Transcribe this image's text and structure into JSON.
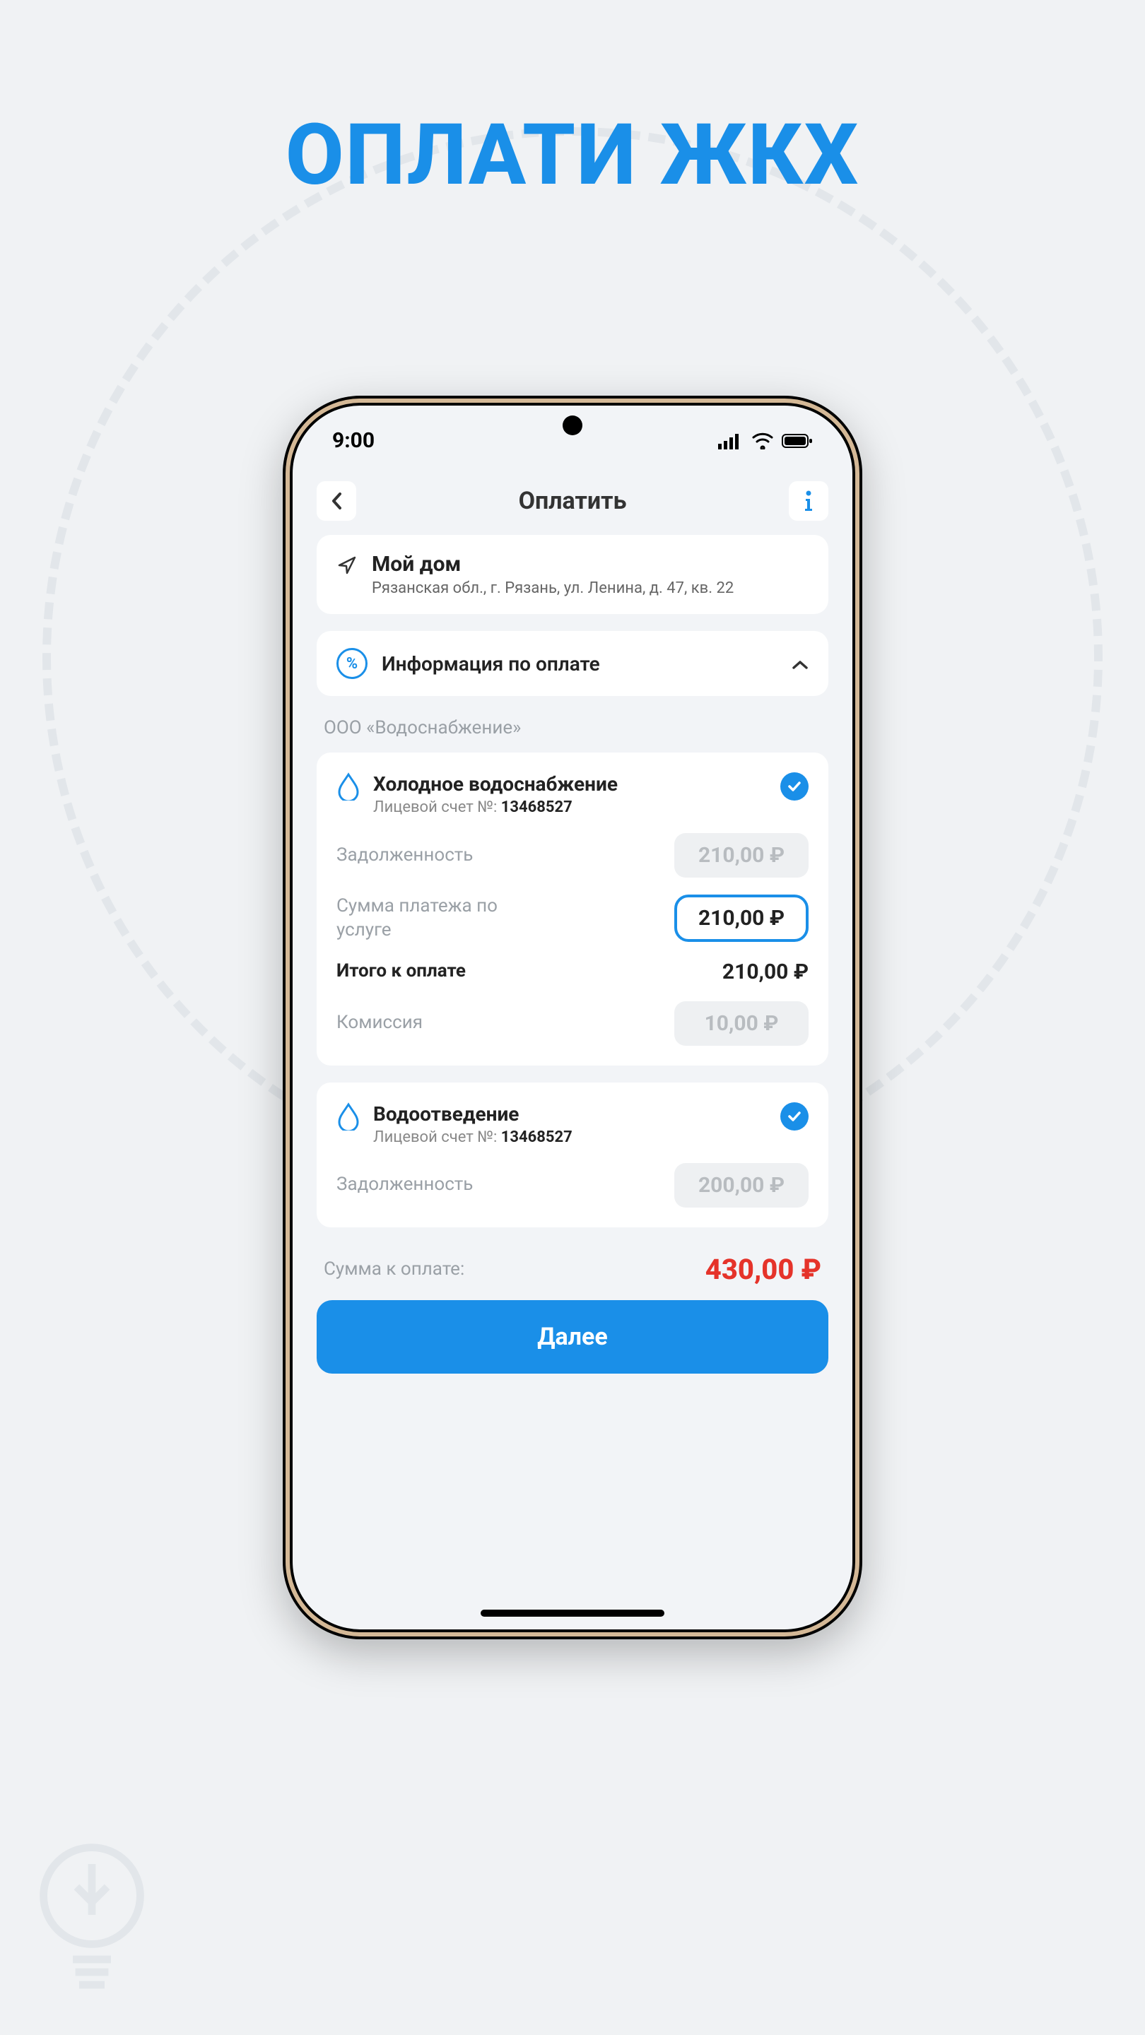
{
  "headline": "ОПЛАТИ ЖКХ",
  "status": {
    "time": "9:00"
  },
  "header": {
    "title": "Оплатить"
  },
  "address": {
    "title": "Мой дом",
    "subtitle": "Рязанская обл., г. Рязань, ул. Ленина, д. 47, кв. 22"
  },
  "payinfo": {
    "label": "Информация по оплате"
  },
  "company": "ООО «Водоснабжение»",
  "services": [
    {
      "title": "Холодное водоснабжение",
      "account_label": "Лицевой счет №:",
      "account": "13468527",
      "rows": {
        "debt_label": "Задолженность",
        "debt_value": "210,00 ₽",
        "amount_label": "Сумма платежа по услуге",
        "amount_value": "210,00 ₽",
        "total_label": "Итого к оплате",
        "total_value": "210,00 ₽",
        "fee_label": "Комиссия",
        "fee_value": "10,00 ₽"
      }
    },
    {
      "title": "Водоотведение",
      "account_label": "Лицевой счет №:",
      "account": "13468527",
      "rows": {
        "debt_label": "Задолженность",
        "debt_value": "200,00 ₽"
      }
    }
  ],
  "summary": {
    "label": "Сумма к оплате:",
    "value": "430,00 ₽"
  },
  "next_button": "Далее"
}
